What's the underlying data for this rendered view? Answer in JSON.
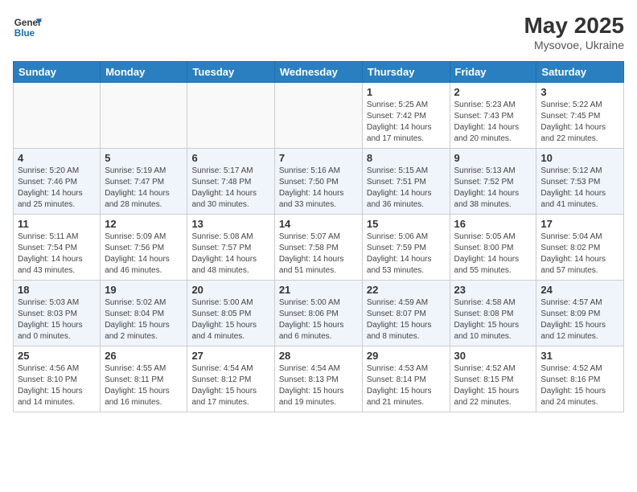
{
  "header": {
    "logo_general": "General",
    "logo_blue": "Blue",
    "month": "May 2025",
    "location": "Mysovoe, Ukraine"
  },
  "days_of_week": [
    "Sunday",
    "Monday",
    "Tuesday",
    "Wednesday",
    "Thursday",
    "Friday",
    "Saturday"
  ],
  "weeks": [
    [
      {
        "day": "",
        "info": ""
      },
      {
        "day": "",
        "info": ""
      },
      {
        "day": "",
        "info": ""
      },
      {
        "day": "",
        "info": ""
      },
      {
        "day": "1",
        "info": "Sunrise: 5:25 AM\nSunset: 7:42 PM\nDaylight: 14 hours\nand 17 minutes."
      },
      {
        "day": "2",
        "info": "Sunrise: 5:23 AM\nSunset: 7:43 PM\nDaylight: 14 hours\nand 20 minutes."
      },
      {
        "day": "3",
        "info": "Sunrise: 5:22 AM\nSunset: 7:45 PM\nDaylight: 14 hours\nand 22 minutes."
      }
    ],
    [
      {
        "day": "4",
        "info": "Sunrise: 5:20 AM\nSunset: 7:46 PM\nDaylight: 14 hours\nand 25 minutes."
      },
      {
        "day": "5",
        "info": "Sunrise: 5:19 AM\nSunset: 7:47 PM\nDaylight: 14 hours\nand 28 minutes."
      },
      {
        "day": "6",
        "info": "Sunrise: 5:17 AM\nSunset: 7:48 PM\nDaylight: 14 hours\nand 30 minutes."
      },
      {
        "day": "7",
        "info": "Sunrise: 5:16 AM\nSunset: 7:50 PM\nDaylight: 14 hours\nand 33 minutes."
      },
      {
        "day": "8",
        "info": "Sunrise: 5:15 AM\nSunset: 7:51 PM\nDaylight: 14 hours\nand 36 minutes."
      },
      {
        "day": "9",
        "info": "Sunrise: 5:13 AM\nSunset: 7:52 PM\nDaylight: 14 hours\nand 38 minutes."
      },
      {
        "day": "10",
        "info": "Sunrise: 5:12 AM\nSunset: 7:53 PM\nDaylight: 14 hours\nand 41 minutes."
      }
    ],
    [
      {
        "day": "11",
        "info": "Sunrise: 5:11 AM\nSunset: 7:54 PM\nDaylight: 14 hours\nand 43 minutes."
      },
      {
        "day": "12",
        "info": "Sunrise: 5:09 AM\nSunset: 7:56 PM\nDaylight: 14 hours\nand 46 minutes."
      },
      {
        "day": "13",
        "info": "Sunrise: 5:08 AM\nSunset: 7:57 PM\nDaylight: 14 hours\nand 48 minutes."
      },
      {
        "day": "14",
        "info": "Sunrise: 5:07 AM\nSunset: 7:58 PM\nDaylight: 14 hours\nand 51 minutes."
      },
      {
        "day": "15",
        "info": "Sunrise: 5:06 AM\nSunset: 7:59 PM\nDaylight: 14 hours\nand 53 minutes."
      },
      {
        "day": "16",
        "info": "Sunrise: 5:05 AM\nSunset: 8:00 PM\nDaylight: 14 hours\nand 55 minutes."
      },
      {
        "day": "17",
        "info": "Sunrise: 5:04 AM\nSunset: 8:02 PM\nDaylight: 14 hours\nand 57 minutes."
      }
    ],
    [
      {
        "day": "18",
        "info": "Sunrise: 5:03 AM\nSunset: 8:03 PM\nDaylight: 15 hours\nand 0 minutes."
      },
      {
        "day": "19",
        "info": "Sunrise: 5:02 AM\nSunset: 8:04 PM\nDaylight: 15 hours\nand 2 minutes."
      },
      {
        "day": "20",
        "info": "Sunrise: 5:00 AM\nSunset: 8:05 PM\nDaylight: 15 hours\nand 4 minutes."
      },
      {
        "day": "21",
        "info": "Sunrise: 5:00 AM\nSunset: 8:06 PM\nDaylight: 15 hours\nand 6 minutes."
      },
      {
        "day": "22",
        "info": "Sunrise: 4:59 AM\nSunset: 8:07 PM\nDaylight: 15 hours\nand 8 minutes."
      },
      {
        "day": "23",
        "info": "Sunrise: 4:58 AM\nSunset: 8:08 PM\nDaylight: 15 hours\nand 10 minutes."
      },
      {
        "day": "24",
        "info": "Sunrise: 4:57 AM\nSunset: 8:09 PM\nDaylight: 15 hours\nand 12 minutes."
      }
    ],
    [
      {
        "day": "25",
        "info": "Sunrise: 4:56 AM\nSunset: 8:10 PM\nDaylight: 15 hours\nand 14 minutes."
      },
      {
        "day": "26",
        "info": "Sunrise: 4:55 AM\nSunset: 8:11 PM\nDaylight: 15 hours\nand 16 minutes."
      },
      {
        "day": "27",
        "info": "Sunrise: 4:54 AM\nSunset: 8:12 PM\nDaylight: 15 hours\nand 17 minutes."
      },
      {
        "day": "28",
        "info": "Sunrise: 4:54 AM\nSunset: 8:13 PM\nDaylight: 15 hours\nand 19 minutes."
      },
      {
        "day": "29",
        "info": "Sunrise: 4:53 AM\nSunset: 8:14 PM\nDaylight: 15 hours\nand 21 minutes."
      },
      {
        "day": "30",
        "info": "Sunrise: 4:52 AM\nSunset: 8:15 PM\nDaylight: 15 hours\nand 22 minutes."
      },
      {
        "day": "31",
        "info": "Sunrise: 4:52 AM\nSunset: 8:16 PM\nDaylight: 15 hours\nand 24 minutes."
      }
    ]
  ]
}
